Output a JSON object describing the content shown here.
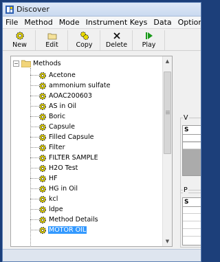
{
  "window": {
    "title": "Discover",
    "icon": "app-icon"
  },
  "menu": [
    "File",
    "Method",
    "Mode",
    "Instrument Keys",
    "Data",
    "Option"
  ],
  "toolbar": [
    {
      "label": "New",
      "icon": "new-gear-icon"
    },
    {
      "label": "Edit",
      "icon": "edit-folder-icon"
    },
    {
      "label": "Copy",
      "icon": "copy-gear-icon"
    },
    {
      "label": "Delete",
      "icon": "delete-x-icon"
    },
    {
      "label": "Play",
      "icon": "play-icon"
    }
  ],
  "tree": {
    "root": "Methods",
    "selected": "MOTOR OIL",
    "items": [
      "Acetone",
      "ammonium sulfate",
      "AOAC200603",
      "AS in Oil",
      "Boric",
      "Capsule",
      "Filled Capsule",
      "Filter",
      "FILTER SAMPLE",
      "H2O Test",
      "HF",
      "HG in Oil",
      "kcl",
      "ldpe",
      "Method Details",
      "MOTOR OIL"
    ]
  },
  "panel": {
    "group1_label": "V",
    "group1_header": "S",
    "group2_label": "P",
    "group2_header": "S"
  },
  "colors": {
    "desktop": "#1c3f7a",
    "selection": "#3399ff",
    "gear_fill": "#e8d800"
  }
}
